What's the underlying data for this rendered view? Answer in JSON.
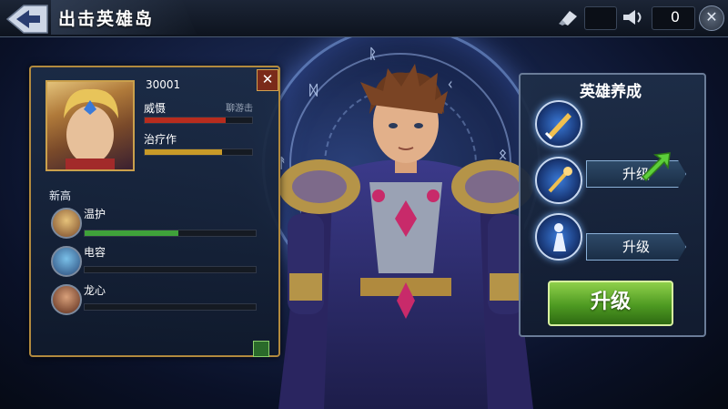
{
  "header": {
    "title": "出击英雄岛",
    "resource_value": "0",
    "icons": [
      "back-icon",
      "horn-icon",
      "speaker-icon",
      "close-icon"
    ]
  },
  "hero_panel": {
    "score": "30001",
    "stats": [
      {
        "label": "威慑",
        "tag": "聊游击",
        "value": 0.75,
        "color": "#b82c1e"
      },
      {
        "label": "治疗作",
        "value": 0.72,
        "color": "#c89a28"
      }
    ],
    "section_title": "新高",
    "teammates": [
      {
        "label": "温护",
        "value": 0.55,
        "color": "#3fa23a"
      },
      {
        "label": "电容",
        "value": 0.0,
        "color": "#3fa23a"
      },
      {
        "label": "龙心",
        "value": 0.0,
        "color": "#3fa23a"
      }
    ]
  },
  "cultivation": {
    "title": "英雄养成",
    "skills": [
      {
        "icon": "sword-skill-icon",
        "button": ""
      },
      {
        "icon": "staff-skill-icon",
        "button": "升级"
      },
      {
        "icon": "figure-skill-icon",
        "button": "升级"
      }
    ],
    "main_button": "升级"
  },
  "colors": {
    "gold": "#c8a04c",
    "accent_green": "#6abf2e",
    "panel_blue": "#1c2c46"
  }
}
